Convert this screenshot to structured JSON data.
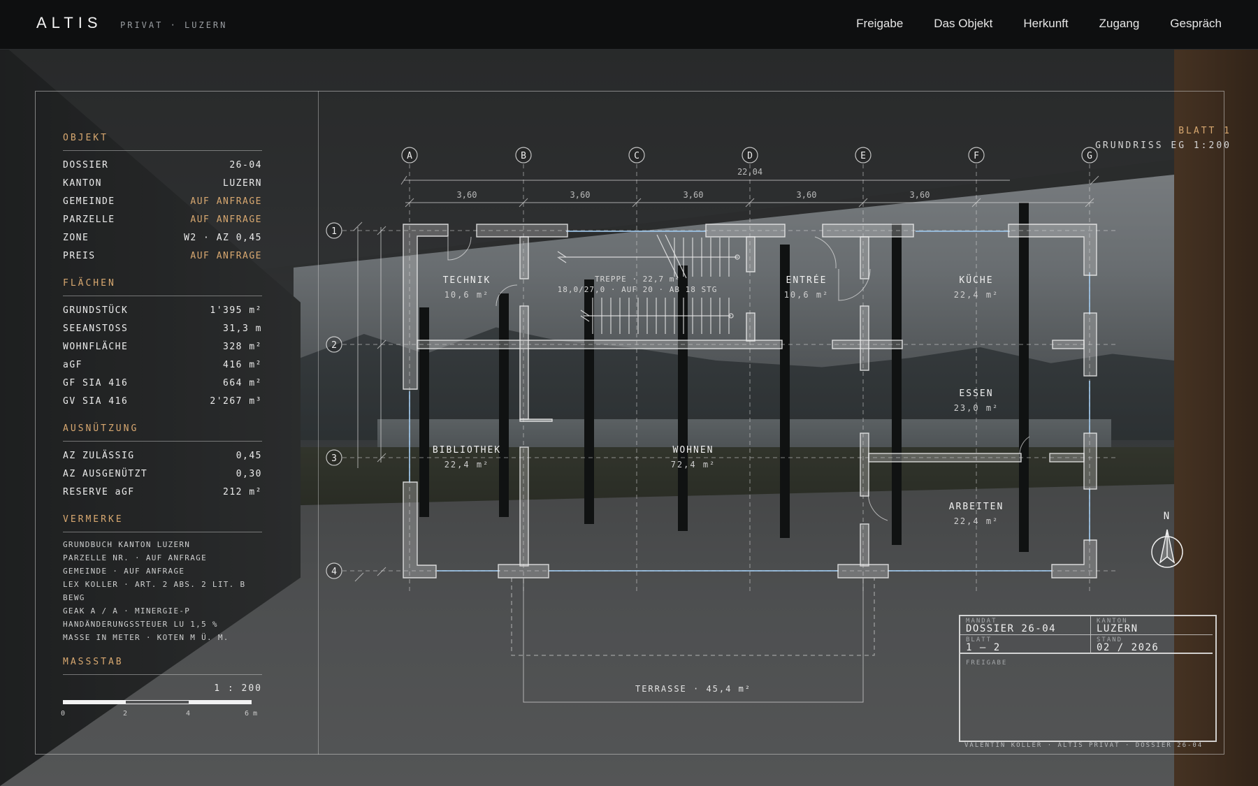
{
  "header": {
    "brand": "ALTIS",
    "subtitle": "PRIVAT · LUZERN",
    "nav": [
      "Freigabe",
      "Das Objekt",
      "Herkunft",
      "Zugang",
      "Gespräch"
    ]
  },
  "sidebar": {
    "objekt": {
      "title": "OBJEKT",
      "rows": [
        {
          "k": "DOSSIER",
          "v": "26-04"
        },
        {
          "k": "KANTON",
          "v": "LUZERN"
        },
        {
          "k": "GEMEINDE",
          "v": "AUF ANFRAGE"
        },
        {
          "k": "PARZELLE",
          "v": "AUF ANFRAGE"
        },
        {
          "k": "ZONE",
          "v": "W2 · AZ 0,45"
        },
        {
          "k": "PREIS",
          "v": "AUF ANFRAGE"
        }
      ]
    },
    "flaechen": {
      "title": "FLÄCHEN",
      "rows": [
        {
          "k": "GRUNDSTÜCK",
          "v": "1'395 m²"
        },
        {
          "k": "SEEANSTOSS",
          "v": "31,3 m"
        },
        {
          "k": "WOHNFLÄCHE",
          "v": "328 m²"
        },
        {
          "k": "aGF",
          "v": "416 m²"
        },
        {
          "k": "GF SIA 416",
          "v": "664 m²"
        },
        {
          "k": "GV SIA 416",
          "v": "2'267 m³"
        }
      ]
    },
    "ausnuetzung": {
      "title": "AUSNÜTZUNG",
      "rows": [
        {
          "k": "AZ ZULÄSSIG",
          "v": "0,45"
        },
        {
          "k": "AZ AUSGENÜTZT",
          "v": "0,30"
        },
        {
          "k": "RESERVE aGF",
          "v": "212 m²"
        }
      ]
    },
    "vermerke": {
      "title": "VERMERKE",
      "lines": [
        "GRUNDBUCH KANTON LUZERN",
        "PARZELLE NR. · AUF ANFRAGE",
        "GEMEINDE · AUF ANFRAGE",
        "LEX KOLLER · ART. 2 ABS. 2 LIT. B BEWG",
        "GEAK A / A · MINERGIE-P",
        "HANDÄNDERUNGSSTEUER LU 1,5 %",
        "MASSE IN METER · KOTEN M Ü. M."
      ]
    },
    "massstab": {
      "title": "MASSSTAB",
      "label": "1 : 200",
      "ticks": [
        "0",
        "2",
        "4",
        "6 m"
      ]
    }
  },
  "plan": {
    "sheet": "BLATT 1",
    "sheet_title": "GRUNDRISS EG 1:200",
    "axes_letters": [
      "A",
      "B",
      "C",
      "D",
      "E",
      "F",
      "G"
    ],
    "axes_numbers": [
      "1",
      "2",
      "3",
      "4"
    ],
    "overall_dim": "22,04",
    "bay_dims": [
      "3,60",
      "3,60",
      "3,60",
      "3,60",
      "3,60"
    ],
    "rooms": [
      {
        "name": "TECHNIK",
        "area": "10,6 m²"
      },
      {
        "name": "ENTRÉE",
        "area": "10,6 m²"
      },
      {
        "name": "KÜCHE",
        "area": "22,4 m²"
      },
      {
        "name": "ESSEN",
        "area": "23,0 m²"
      },
      {
        "name": "BIBLIOTHEK",
        "area": "22,4 m²"
      },
      {
        "name": "WOHNEN",
        "area": "72,4 m²"
      },
      {
        "name": "ARBEITEN",
        "area": "22,4 m²"
      }
    ],
    "stair_line1": "TREPPE · 22,7 m²",
    "stair_line2": "18,0/27,0 · AUF 20 · AB 18 STG",
    "terrace": "TERRASSE · 45,4 m²",
    "north": "N"
  },
  "title_block": {
    "mandat_k": "MANDAT",
    "mandat_v": "DOSSIER 26-04",
    "kanton_k": "KANTON",
    "kanton_v": "LUZERN",
    "blatt_k": "BLATT",
    "blatt_v": "1 — 2",
    "stand_k": "STAND",
    "stand_v": "02 / 2026",
    "freigabe_k": "FREIGABE"
  },
  "footer": "VALENTIN KÖLLER · ALTIS PRIVAT · DOSSIER 26-04",
  "colors": {
    "accent": "#d8a870",
    "line": "#e8e8e8",
    "blue": "#9cc4e8"
  }
}
